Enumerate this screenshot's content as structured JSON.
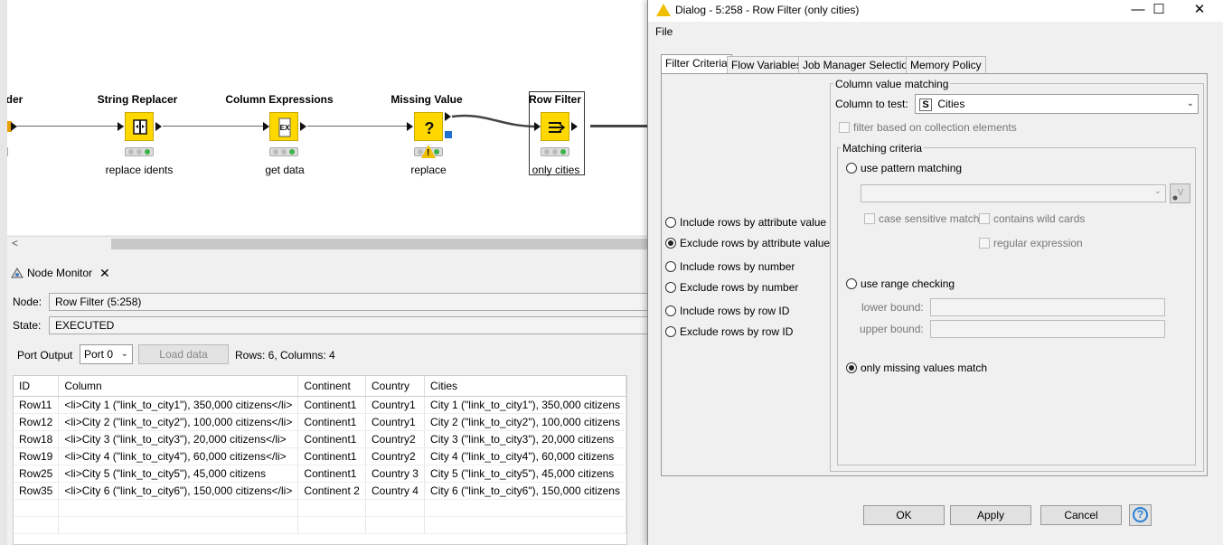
{
  "canvas": {
    "cut_node_title": "der",
    "nodes": [
      {
        "title": "String Replacer",
        "label": "replace idents",
        "icon": "string-replacer-icon"
      },
      {
        "title": "Column Expressions",
        "label": "get data",
        "icon": "expression-icon"
      },
      {
        "title": "Missing Value",
        "label": "replace",
        "icon": "question-icon"
      },
      {
        "title": "Row Filter",
        "label": "only cities",
        "icon": "filter-icon"
      }
    ],
    "scroll_left": "<"
  },
  "monitor": {
    "tab_label": "Node Monitor",
    "node_label": "Node:",
    "node_value": "Row Filter  (5:258)",
    "state_label": "State:",
    "state_value": "EXECUTED",
    "port_output_label": "Port Output",
    "port_value": "Port 0",
    "load_data": "Load data",
    "rows_cols": "Rows: 6, Columns: 4",
    "table": {
      "headers": [
        "ID",
        "Column",
        "Continent",
        "Country",
        "Cities"
      ],
      "rows": [
        [
          "Row11",
          "<li>City 1 (\"link_to_city1\"), 350,000 citizens</li>",
          "Continent1",
          "Country1",
          "City 1 (\"link_to_city1\"), 350,000 citizens"
        ],
        [
          "Row12",
          "<li>City 2 (\"link_to_city2\"), 100,000 citizens</li>",
          "Continent1",
          "Country1",
          "City 2 (\"link_to_city2\"), 100,000 citizens"
        ],
        [
          "Row18",
          "<li>City 3 (\"link_to_city3\"), 20,000 citizens</li>",
          "Continent1",
          "Country2",
          "City 3 (\"link_to_city3\"), 20,000 citizens"
        ],
        [
          "Row19",
          "<li>City 4 (\"link_to_city4\"), 60,000 citizens</li>",
          "Continent1",
          "Country2",
          "City 4 (\"link_to_city4\"), 60,000 citizens"
        ],
        [
          "Row25",
          "<li>City 5 (\"link_to_city5\"), 45,000 citizens",
          "Continent1",
          "Country 3",
          "City 5 (\"link_to_city5\"), 45,000 citizens"
        ],
        [
          "Row35",
          "<li>City 6 (\"link_to_city6\"), 150,000 citizens</li>",
          "Continent 2",
          "Country 4",
          "City 6 (\"link_to_city6\"), 150,000 citizens"
        ]
      ]
    }
  },
  "dialog": {
    "title": "Dialog - 5:258 - Row Filter (only cities)",
    "menu_file": "File",
    "tabs": [
      "Filter Criteria",
      "Flow Variables",
      "Job Manager Selection",
      "Memory Policy"
    ],
    "mode_options": [
      {
        "label": "Include rows by attribute value",
        "selected": false
      },
      {
        "label": "Exclude rows by attribute value",
        "selected": true
      },
      {
        "label": "Include rows by number",
        "selected": false
      },
      {
        "label": "Exclude rows by number",
        "selected": false
      },
      {
        "label": "Include rows by row ID",
        "selected": false
      },
      {
        "label": "Exclude rows by row ID",
        "selected": false
      }
    ],
    "column_value_matching": "Column value matching",
    "column_to_test_label": "Column to test:",
    "column_type_badge": "S",
    "column_to_test_value": "Cities",
    "filter_collection": "filter based on collection elements",
    "matching_criteria": "Matching criteria",
    "use_pattern": "use pattern matching",
    "case_sensitive": "case sensitive match",
    "contains_wild": "contains wild cards",
    "regular_expression": "regular expression",
    "use_range": "use range checking",
    "lower_bound": "lower bound:",
    "upper_bound": "upper bound:",
    "only_missing": "only missing values match",
    "buttons": {
      "ok": "OK",
      "apply": "Apply",
      "cancel": "Cancel",
      "help": "?"
    }
  }
}
